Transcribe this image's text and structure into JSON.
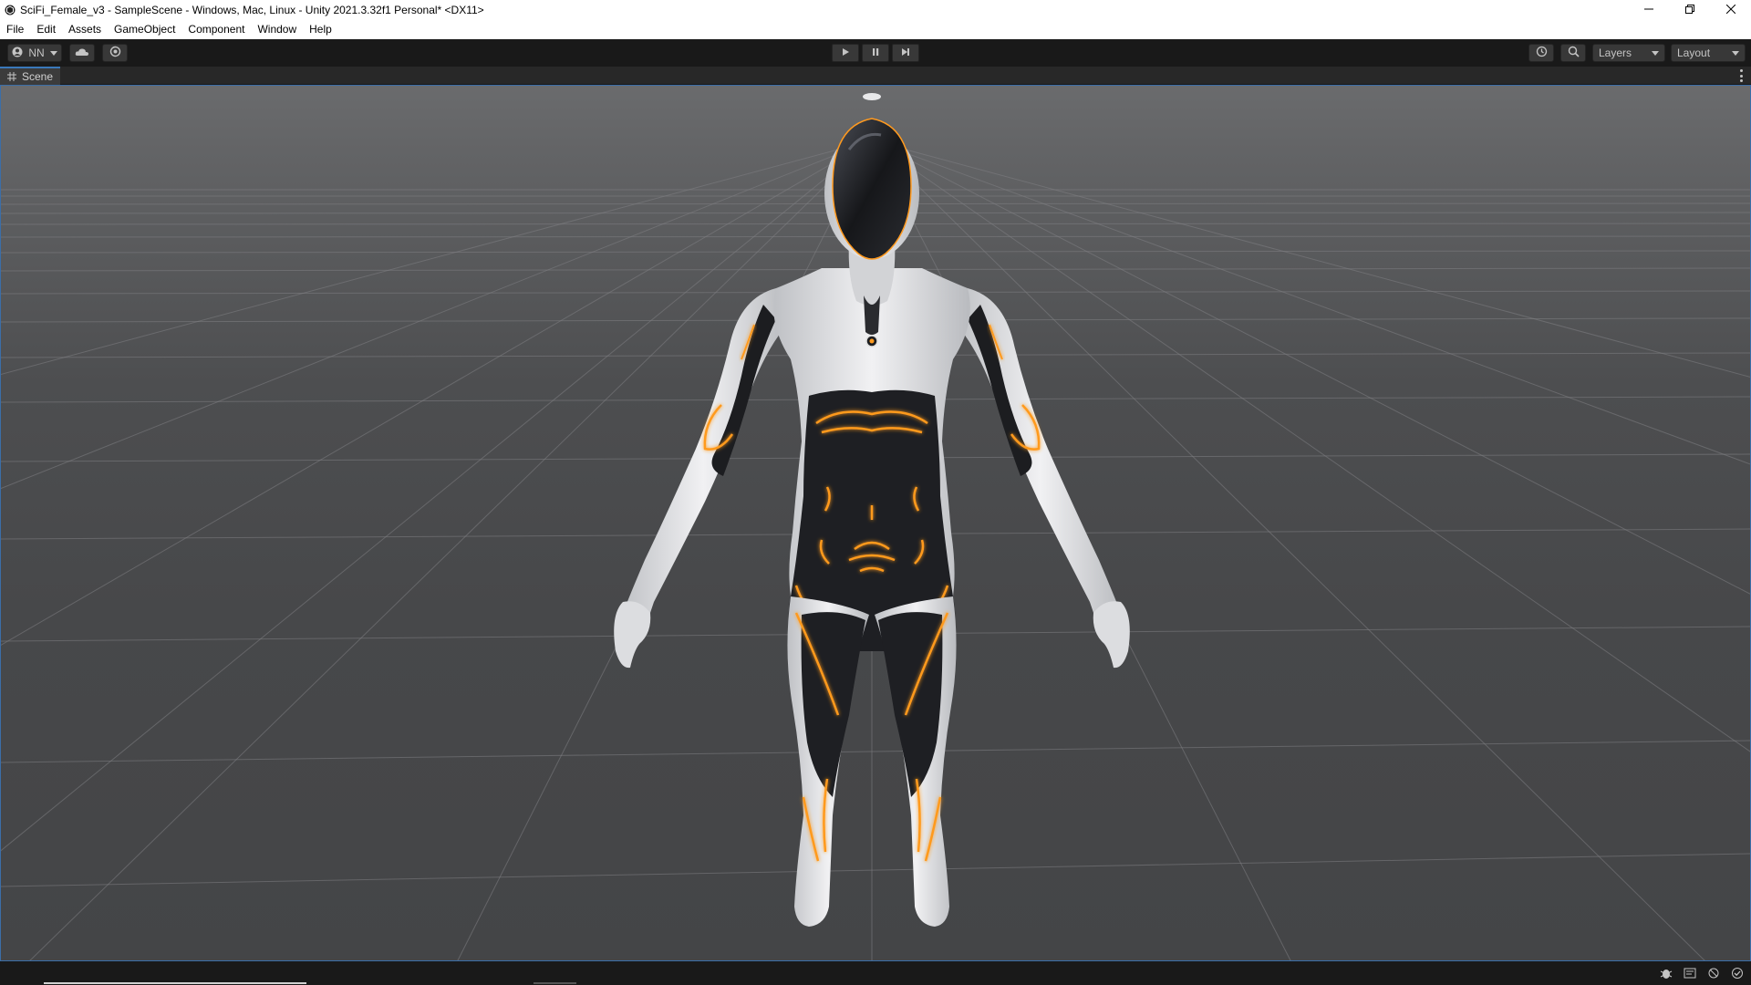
{
  "window": {
    "title": "SciFi_Female_v3 - SampleScene - Windows, Mac, Linux - Unity 2021.3.32f1 Personal* <DX11>"
  },
  "menu": {
    "items": [
      "File",
      "Edit",
      "Assets",
      "GameObject",
      "Component",
      "Window",
      "Help"
    ]
  },
  "toolbar": {
    "account_label": "NN",
    "layers_label": "Layers",
    "layout_label": "Layout"
  },
  "scene_view": {
    "tab_label": "Scene"
  },
  "colors": {
    "accent": "#3a79bb",
    "suit_glow": "#ff9a1f",
    "suit_white": "#e8e8ea",
    "suit_black": "#1c1d20"
  },
  "icons": [
    "unity-logo-icon",
    "minimize-icon",
    "restore-icon",
    "close-icon",
    "account-icon",
    "cloud-icon",
    "collab-icon",
    "play-icon",
    "pause-icon",
    "step-icon",
    "history-icon",
    "search-icon",
    "scene-hash-icon",
    "kebab-menu-icon",
    "bug-icon",
    "console-icon",
    "debug-icon",
    "checkmark-icon"
  ]
}
